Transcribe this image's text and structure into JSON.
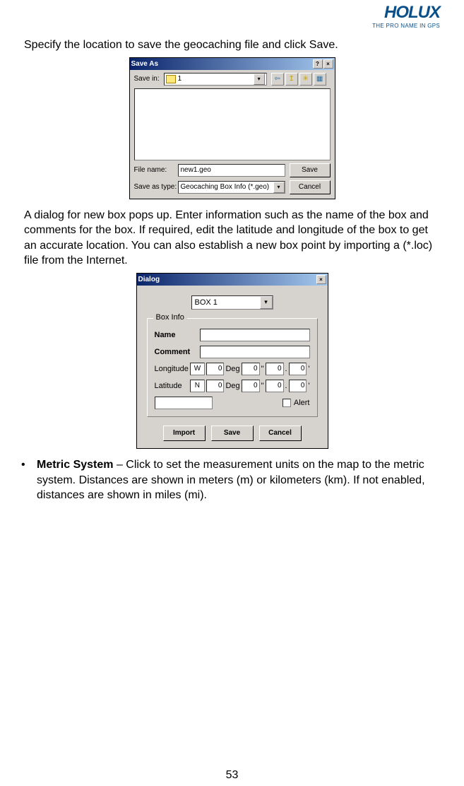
{
  "logo": {
    "name": "HOLUX",
    "tagline": "THE PRO NAME IN GPS"
  },
  "para1": "Specify the location to save the geocaching file and click Save.",
  "saveas": {
    "title": "Save As",
    "help_glyph": "?",
    "close_glyph": "×",
    "savein_label": "Save in:",
    "savein_value": "1",
    "filename_label": "File name:",
    "filename_value": "new1.geo",
    "saveastype_label": "Save as type:",
    "saveastype_value": "Geocaching Box Info (*.geo)",
    "save_btn": "Save",
    "cancel_btn": "Cancel",
    "dd_glyph": "▾",
    "back_glyph": "⇦",
    "up_glyph": "↥",
    "new_glyph": "✳",
    "view_glyph": "▦"
  },
  "para2": "A dialog for new box pops up. Enter information such as the name of the box and comments for the box. If required, edit the latitude and longitude of the box to get an accurate location. You can also establish a new box point by importing a (*.loc) file from the Internet.",
  "boxdlg": {
    "title": "Dialog",
    "close_glyph": "×",
    "selector_value": "BOX 1",
    "dd_glyph": "▾",
    "group_title": "Box Info",
    "name_label": "Name",
    "comment_label": "Comment",
    "longitude_label": "Longitude",
    "latitude_label": "Latitude",
    "lon_dir": "W",
    "lat_dir": "N",
    "deg_label": "Deg",
    "zero": "0",
    "tick2": "''",
    "dot": ".",
    "tick1": "'",
    "alert_label": "Alert",
    "import_btn": "Import",
    "save_btn": "Save",
    "cancel_btn": "Cancel"
  },
  "bullet": {
    "dot": "•",
    "bold": "Metric System",
    "rest": " – Click to set the measurement units on the map to the metric system. Distances are shown in meters (m) or kilometers (km). If not enabled, distances are shown in miles (mi)."
  },
  "page_number": "53"
}
